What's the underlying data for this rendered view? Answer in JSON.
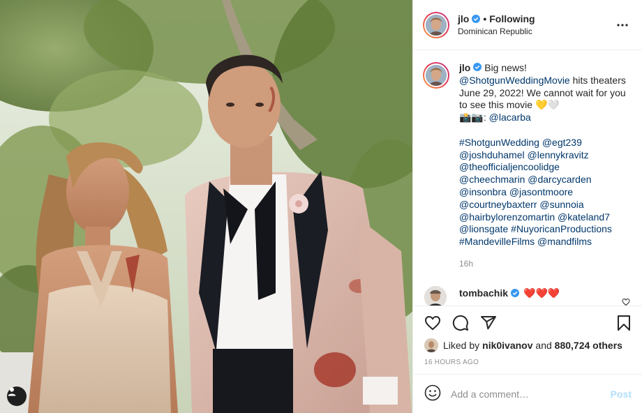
{
  "post": {
    "username": "jlo",
    "follow_status": "Following",
    "location": "Dominican Republic",
    "separator": "•"
  },
  "caption": {
    "username": "jlo",
    "line1": "Big news!",
    "mention_movie": "@ShotgunWeddingMovie",
    "line2a": " hits theaters June 29, 2022! We cannot wait for you to see this movie ",
    "emoji_hearts": "💛🤍",
    "photo_emoji": "📸📷: ",
    "credit": "@lacarba",
    "tags": [
      "#ShotgunWedding",
      " ",
      "@egt239",
      " ",
      "@joshduhamel",
      " ",
      "@lennykravitz",
      " ",
      "@theofficialjencoolidge",
      " ",
      "@cheechmarin",
      " ",
      "@darcycarden",
      " ",
      "@insonbra",
      " ",
      "@jasontmoore",
      " ",
      "@courtneybaxterr",
      " ",
      "@sunnoia",
      " ",
      "@hairbylorenzomartin",
      " ",
      "@kateland7",
      " ",
      "@lionsgate",
      " ",
      "#NuyoricanProductions",
      " ",
      "#MandevilleFilms",
      " ",
      "@mandfilms"
    ],
    "time": "16h"
  },
  "comment": {
    "username": "tombachik",
    "text": "❤️❤️❤️"
  },
  "likes": {
    "prefix": "Liked by ",
    "user": "nik0ivanov",
    "middle": " and ",
    "count": "880,724 others"
  },
  "timestamp": "16 HOURS AGO",
  "add_comment": {
    "placeholder": "Add a comment…",
    "post_label": "Post"
  },
  "icons": {
    "more": "more-dots-icon",
    "like": "heart-outline-icon",
    "comment": "comment-bubble-icon",
    "share": "paper-plane-icon",
    "save": "bookmark-icon",
    "emoji": "smiley-icon",
    "tag": "user-tag-icon",
    "verified": "verified-badge-icon"
  },
  "colors": {
    "verified": "#3897f0",
    "link": "#00376b",
    "muted": "#8e8e8e",
    "post_disabled": "#b2dffc"
  }
}
